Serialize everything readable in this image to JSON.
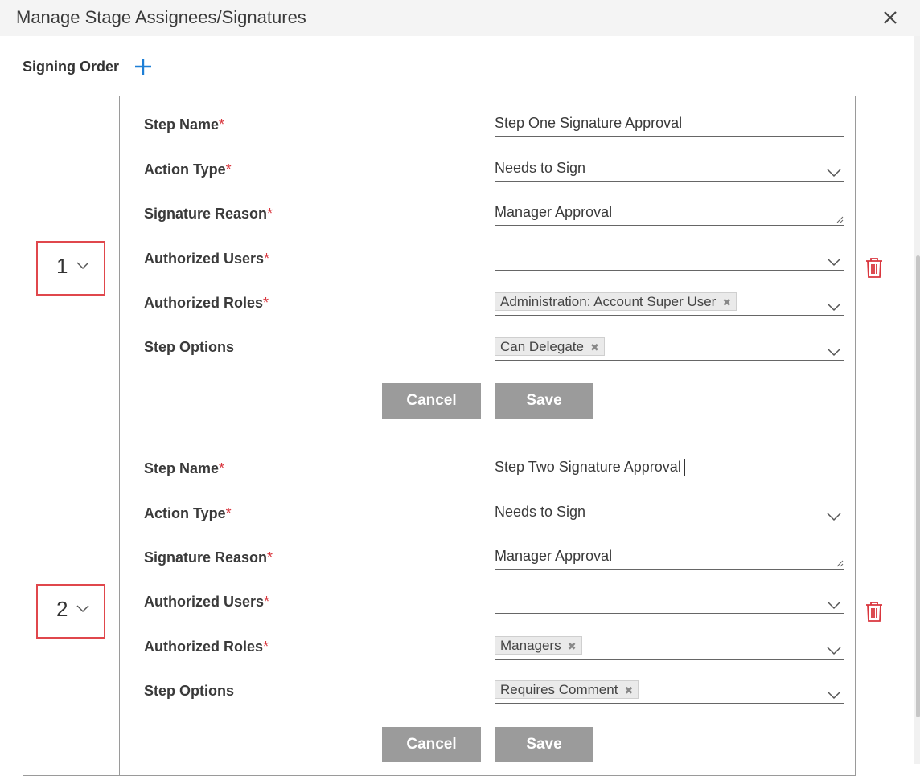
{
  "dialog": {
    "title": "Manage Stage Assignees/Signatures",
    "close_icon": "close-icon"
  },
  "signing_order": {
    "label": "Signing Order",
    "add_icon": "plus-icon"
  },
  "colors": {
    "required": "#d9363e",
    "accent": "#1e7fd6",
    "button": "#9b9b9b",
    "highlight_border": "#e0474c",
    "trash": "#d9363e"
  },
  "steps": [
    {
      "order": "1",
      "fields": {
        "step_name": {
          "label": "Step Name",
          "required": "*",
          "value": "Step One Signature Approval"
        },
        "action_type": {
          "label": "Action Type",
          "required": "*",
          "value": "Needs to Sign"
        },
        "signature_reason": {
          "label": "Signature Reason",
          "required": "*",
          "value": "Manager Approval"
        },
        "authorized_users": {
          "label": "Authorized Users",
          "required": "*",
          "value": ""
        },
        "authorized_roles": {
          "label": "Authorized Roles",
          "required": "*",
          "tags": [
            "Administration: Account Super User"
          ]
        },
        "step_options": {
          "label": "Step Options",
          "tags": [
            "Can Delegate"
          ]
        }
      },
      "cancel_label": "Cancel",
      "save_label": "Save"
    },
    {
      "order": "2",
      "fields": {
        "step_name": {
          "label": "Step Name",
          "required": "*",
          "value": "Step Two Signature Approval"
        },
        "action_type": {
          "label": "Action Type",
          "required": "*",
          "value": "Needs to Sign"
        },
        "signature_reason": {
          "label": "Signature Reason",
          "required": "*",
          "value": "Manager Approval"
        },
        "authorized_users": {
          "label": "Authorized Users",
          "required": "*",
          "value": ""
        },
        "authorized_roles": {
          "label": "Authorized Roles",
          "required": "*",
          "tags": [
            "Managers"
          ]
        },
        "step_options": {
          "label": "Step Options",
          "tags": [
            "Requires Comment"
          ]
        }
      },
      "cancel_label": "Cancel",
      "save_label": "Save"
    }
  ]
}
